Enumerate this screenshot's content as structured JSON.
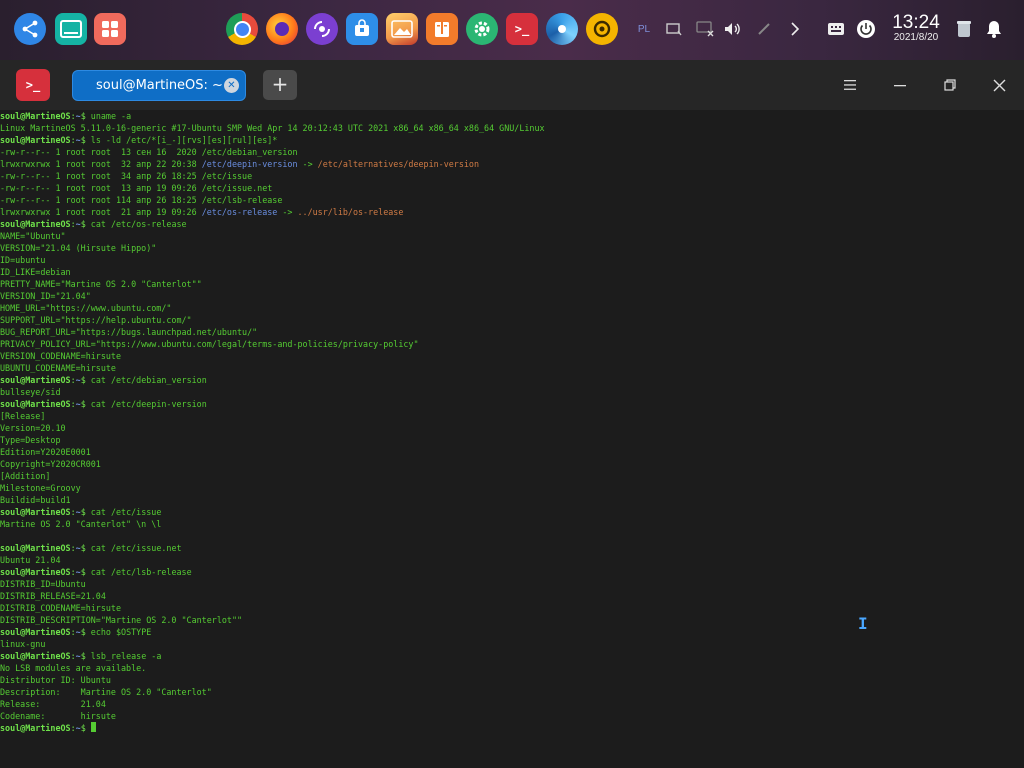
{
  "dock": {
    "left_apps": [
      {
        "name": "launcher",
        "icon": "launcher-icon",
        "color": "#2f86e6"
      },
      {
        "name": "multitask-view",
        "icon": "multitask-icon",
        "color": "#15b3a4"
      },
      {
        "name": "workspace",
        "icon": "workspace-icon",
        "color": "#f06a5c"
      }
    ],
    "apps": [
      {
        "name": "chrome",
        "icon": "chrome-icon",
        "color": "#e84b3c"
      },
      {
        "name": "firefox",
        "icon": "firefox-icon",
        "color": "#ff7a1a"
      },
      {
        "name": "music",
        "icon": "music-icon",
        "color": "#7b3fd1"
      },
      {
        "name": "app-store",
        "icon": "app-store-icon",
        "color": "#2e8ee8"
      },
      {
        "name": "image-viewer",
        "icon": "image-viewer-icon",
        "color": "#f2994a"
      },
      {
        "name": "archive",
        "icon": "archive-icon",
        "color": "#f27b2b"
      },
      {
        "name": "settings",
        "icon": "gear-icon",
        "color": "#2bb673"
      },
      {
        "name": "terminal",
        "icon": "terminal-icon",
        "color": "#d6303c"
      },
      {
        "name": "browser",
        "icon": "swirl-icon",
        "color": "#3aa0e8"
      },
      {
        "name": "sync",
        "icon": "sync-icon",
        "color": "#f4b400"
      }
    ],
    "tray": {
      "keyboard_layout": "PL",
      "clock_time": "13:24",
      "clock_date": "2021/8/20"
    }
  },
  "window": {
    "tab_title": "soul@MartineOS: ~",
    "new_tab_label": "+"
  },
  "terminal": {
    "prompt_user": "soul@MartineOS",
    "prompt_path": "~",
    "lines": [
      {
        "kind": "cmd",
        "text": "uname -a"
      },
      {
        "kind": "out",
        "text": "Linux MartineOS 5.11.0-16-generic #17-Ubuntu SMP Wed Apr 14 20:12:43 UTC 2021 x86_64 x86_64 x86_64 GNU/Linux"
      },
      {
        "kind": "cmd",
        "text": "ls -ld /etc/*[i_-][rvs][es][rul][es]*"
      },
      {
        "kind": "ls",
        "meta": "-rw-r--r-- 1 root root  13 сен 16  2020 ",
        "file": "/etc/debian_version"
      },
      {
        "kind": "ls",
        "meta": "lrwxrwxrwx 1 root root  32 апр 22 20:38 ",
        "file": "/etc/deepin-version",
        "link": true,
        "arrow": " -> ",
        "target": "/etc/alternatives/deepin-version"
      },
      {
        "kind": "ls",
        "meta": "-rw-r--r-- 1 root root  34 апр 26 18:25 ",
        "file": "/etc/issue"
      },
      {
        "kind": "ls",
        "meta": "-rw-r--r-- 1 root root  13 апр 19 09:26 ",
        "file": "/etc/issue.net"
      },
      {
        "kind": "ls",
        "meta": "-rw-r--r-- 1 root root 114 апр 26 18:25 ",
        "file": "/etc/lsb-release"
      },
      {
        "kind": "ls",
        "meta": "lrwxrwxrwx 1 root root  21 апр 19 09:26 ",
        "file": "/etc/os-release",
        "link": true,
        "arrow": " -> ",
        "target": "../usr/lib/os-release"
      },
      {
        "kind": "cmd",
        "text": "cat /etc/os-release"
      },
      {
        "kind": "out",
        "text": "NAME=\"Ubuntu\""
      },
      {
        "kind": "out",
        "text": "VERSION=\"21.04 (Hirsute Hippo)\""
      },
      {
        "kind": "out",
        "text": "ID=ubuntu"
      },
      {
        "kind": "out",
        "text": "ID_LIKE=debian"
      },
      {
        "kind": "out",
        "text": "PRETTY_NAME=\"Martine OS 2.0 \"Canterlot\"\""
      },
      {
        "kind": "out",
        "text": "VERSION_ID=\"21.04\""
      },
      {
        "kind": "out",
        "text": "HOME_URL=\"https://www.ubuntu.com/\""
      },
      {
        "kind": "out",
        "text": "SUPPORT_URL=\"https://help.ubuntu.com/\""
      },
      {
        "kind": "out",
        "text": "BUG_REPORT_URL=\"https://bugs.launchpad.net/ubuntu/\""
      },
      {
        "kind": "out",
        "text": "PRIVACY_POLICY_URL=\"https://www.ubuntu.com/legal/terms-and-policies/privacy-policy\""
      },
      {
        "kind": "out",
        "text": "VERSION_CODENAME=hirsute"
      },
      {
        "kind": "out",
        "text": "UBUNTU_CODENAME=hirsute"
      },
      {
        "kind": "cmd",
        "text": "cat /etc/debian_version"
      },
      {
        "kind": "out",
        "text": "bullseye/sid"
      },
      {
        "kind": "cmd",
        "text": "cat /etc/deepin-version"
      },
      {
        "kind": "out",
        "text": "[Release]"
      },
      {
        "kind": "out",
        "text": "Version=20.10"
      },
      {
        "kind": "out",
        "text": "Type=Desktop"
      },
      {
        "kind": "out",
        "text": "Edition=Y2020E0001"
      },
      {
        "kind": "out",
        "text": "Copyright=Y2020CR001"
      },
      {
        "kind": "out",
        "text": "[Addition]"
      },
      {
        "kind": "out",
        "text": "Milestone=Groovy"
      },
      {
        "kind": "out",
        "text": "Buildid=build1"
      },
      {
        "kind": "cmd",
        "text": "cat /etc/issue"
      },
      {
        "kind": "out",
        "text": "Martine OS 2.0 \"Canterlot\" \\n \\l"
      },
      {
        "kind": "out",
        "text": ""
      },
      {
        "kind": "cmd",
        "text": "cat /etc/issue.net"
      },
      {
        "kind": "out",
        "text": "Ubuntu 21.04"
      },
      {
        "kind": "cmd",
        "text": "cat /etc/lsb-release"
      },
      {
        "kind": "out",
        "text": "DISTRIB_ID=Ubuntu"
      },
      {
        "kind": "out",
        "text": "DISTRIB_RELEASE=21.04"
      },
      {
        "kind": "out",
        "text": "DISTRIB_CODENAME=hirsute"
      },
      {
        "kind": "out",
        "text": "DISTRIB_DESCRIPTION=\"Martine OS 2.0 \"Canterlot\"\""
      },
      {
        "kind": "cmd",
        "text": "echo $OSTYPE"
      },
      {
        "kind": "out",
        "text": "linux-gnu"
      },
      {
        "kind": "cmd",
        "text": "lsb_release -a"
      },
      {
        "kind": "out",
        "text": "No LSB modules are available."
      },
      {
        "kind": "out",
        "text": "Distributor ID:\tUbuntu"
      },
      {
        "kind": "out",
        "text": "Description:\tMartine OS 2.0 \"Canterlot\""
      },
      {
        "kind": "out",
        "text": "Release:\t21.04"
      },
      {
        "kind": "out",
        "text": "Codename:\thirsute"
      },
      {
        "kind": "prompt",
        "text": ""
      }
    ]
  }
}
